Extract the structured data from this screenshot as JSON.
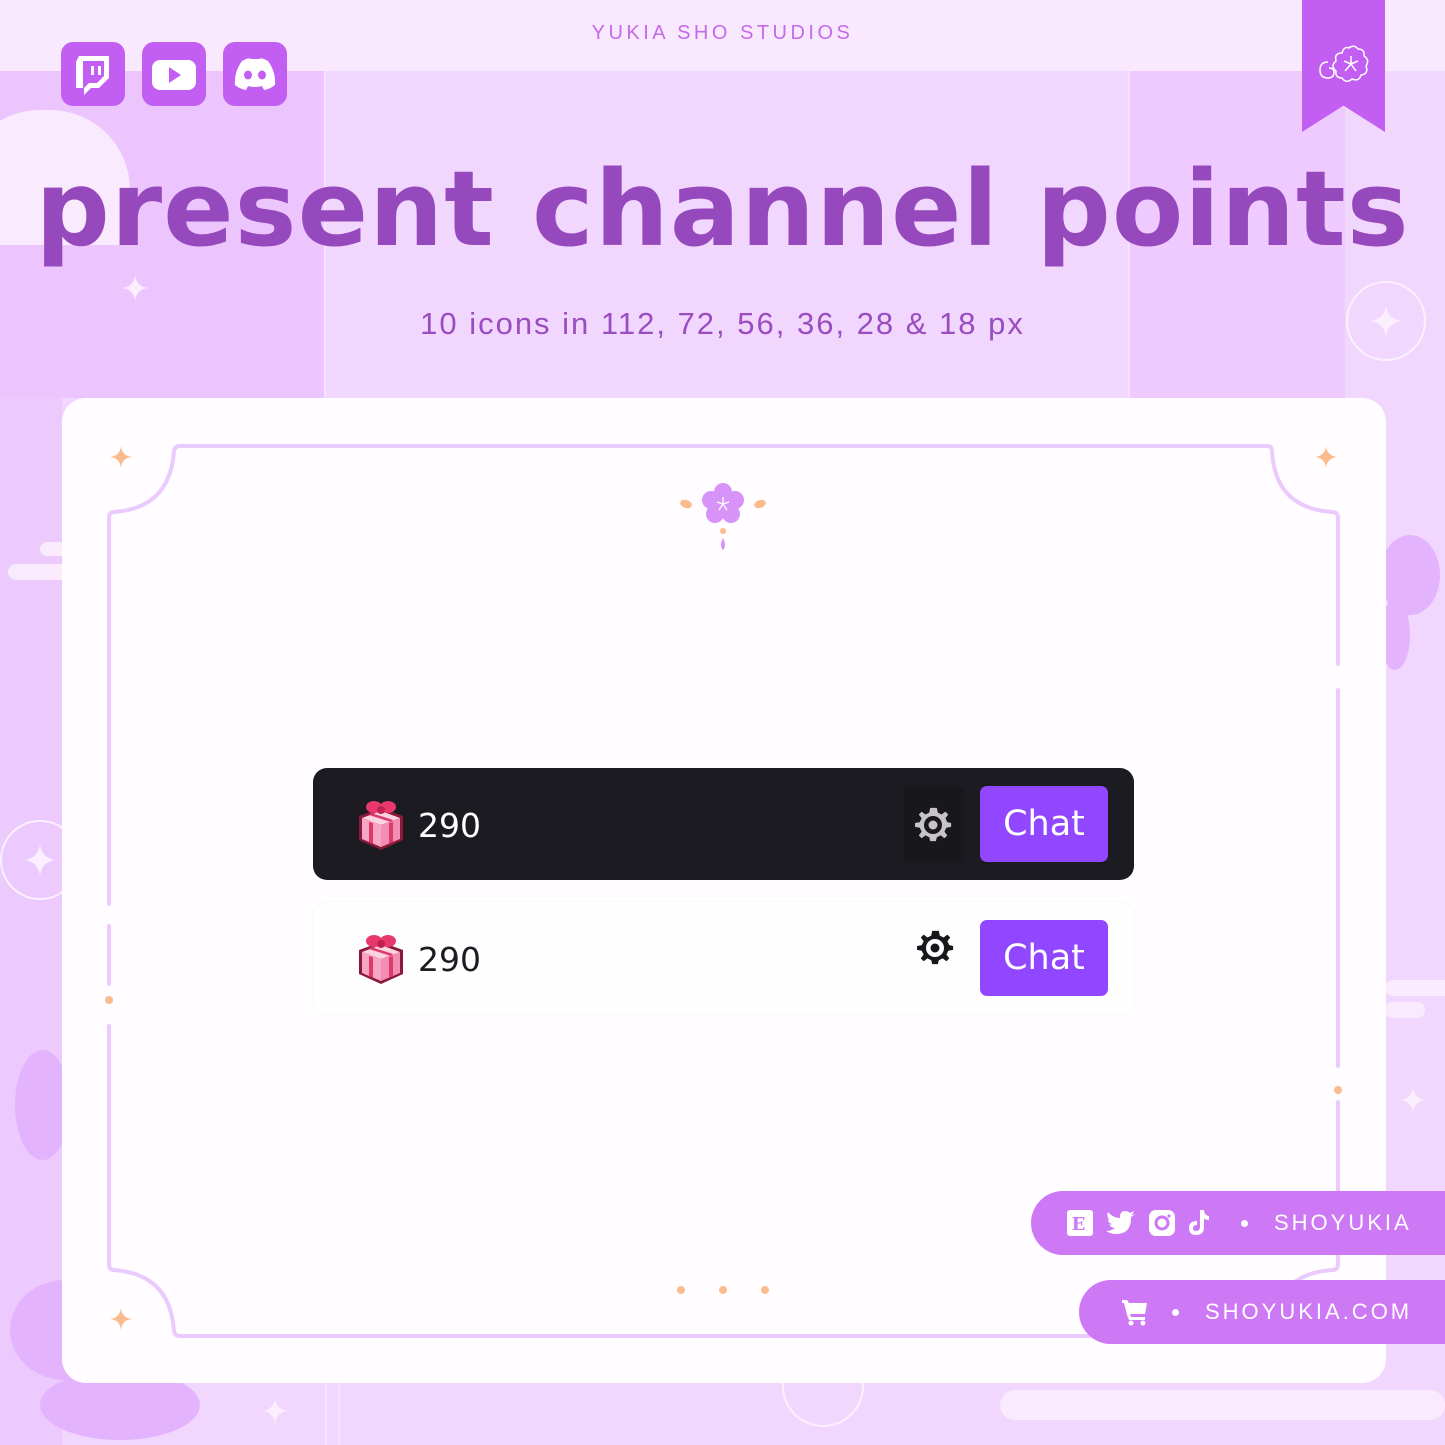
{
  "header": {
    "brand": "YUKIA SHO STUDIOS",
    "title": "present channel points",
    "subtitle": "10 icons in 112, 72, 56, 36, 28 & 18 px"
  },
  "socials": [
    {
      "name": "twitch",
      "icon": "twitch-icon"
    },
    {
      "name": "youtube",
      "icon": "youtube-icon"
    },
    {
      "name": "discord",
      "icon": "discord-icon"
    }
  ],
  "ribbon": {
    "icon": "sakura-cloud-icon"
  },
  "preview": {
    "dark": {
      "points": "290",
      "chat_label": "Chat",
      "icon": "gift-icon",
      "settings_icon": "gear-icon"
    },
    "light": {
      "points": "290",
      "chat_label": "Chat",
      "icon": "gift-icon",
      "settings_icon": "gear-icon"
    }
  },
  "footer": {
    "social_handle": "SHOYUKIA",
    "social_icons": [
      "etsy-icon",
      "twitter-icon",
      "instagram-icon",
      "tiktok-icon"
    ],
    "shop_url": "SHOYUKIA.COM",
    "shop_icon": "cart-icon"
  },
  "colors": {
    "accent": "#c25ff2",
    "title": "#9649bd",
    "twitch_purple": "#9146ff",
    "dark_panel": "#1c1b21",
    "pill": "#cd78f4",
    "frame": "#ebcbfd",
    "sparkle": "#fbbb8c"
  }
}
